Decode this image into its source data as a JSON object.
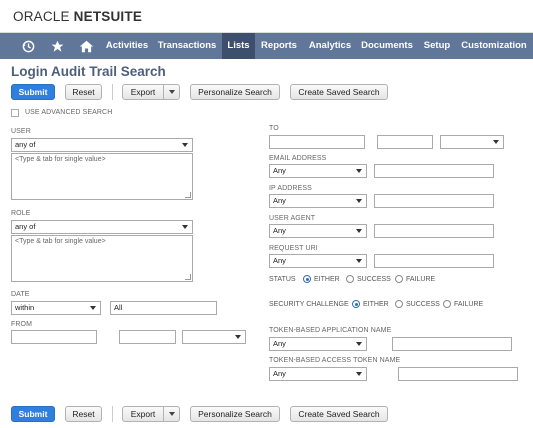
{
  "brand": {
    "oracle": "ORACLE",
    "netsuite": "NETSUITE"
  },
  "nav": {
    "icons": [
      "history-icon",
      "star-icon",
      "home-icon"
    ],
    "items": [
      "Activities",
      "Transactions",
      "Lists",
      "Reports",
      "Analytics",
      "Documents",
      "Setup",
      "Customization"
    ],
    "active": "Lists"
  },
  "page": {
    "title": "Login Audit Trail Search"
  },
  "toolbar": {
    "submit": "Submit",
    "reset": "Reset",
    "export": "Export",
    "personalize": "Personalize Search",
    "create_saved": "Create Saved Search"
  },
  "form": {
    "use_advanced": "USE ADVANCED SEARCH",
    "user_label": "USER",
    "user_op": "any of",
    "user_placeholder": "<Type & tab for single value>",
    "role_label": "ROLE",
    "role_op": "any of",
    "role_placeholder": "<Type & tab for single value>",
    "date_label": "DATE",
    "date_op": "within",
    "date_value": "All",
    "from_label": "FROM",
    "to_label": "TO",
    "email_label": "EMAIL ADDRESS",
    "email_op": "Any",
    "ip_label": "IP ADDRESS",
    "ip_op": "Any",
    "agent_label": "USER AGENT",
    "agent_op": "Any",
    "uri_label": "REQUEST URI",
    "uri_op": "Any",
    "status_label": "STATUS",
    "status_options": [
      "EITHER",
      "SUCCESS",
      "FAILURE"
    ],
    "status_selected": "EITHER",
    "challenge_label": "SECURITY CHALLENGE",
    "challenge_options": [
      "EITHER",
      "SUCCESS",
      "FAILURE"
    ],
    "challenge_selected": "EITHER",
    "token_app_label": "TOKEN-BASED APPLICATION NAME",
    "token_app_op": "Any",
    "token_access_label": "TOKEN-BASED ACCESS TOKEN NAME",
    "token_access_op": "Any"
  },
  "colors": {
    "nav_bg": "#607799",
    "nav_active": "#3e4f6e",
    "primary": "#2f7fde",
    "title": "#4d5f7a"
  }
}
